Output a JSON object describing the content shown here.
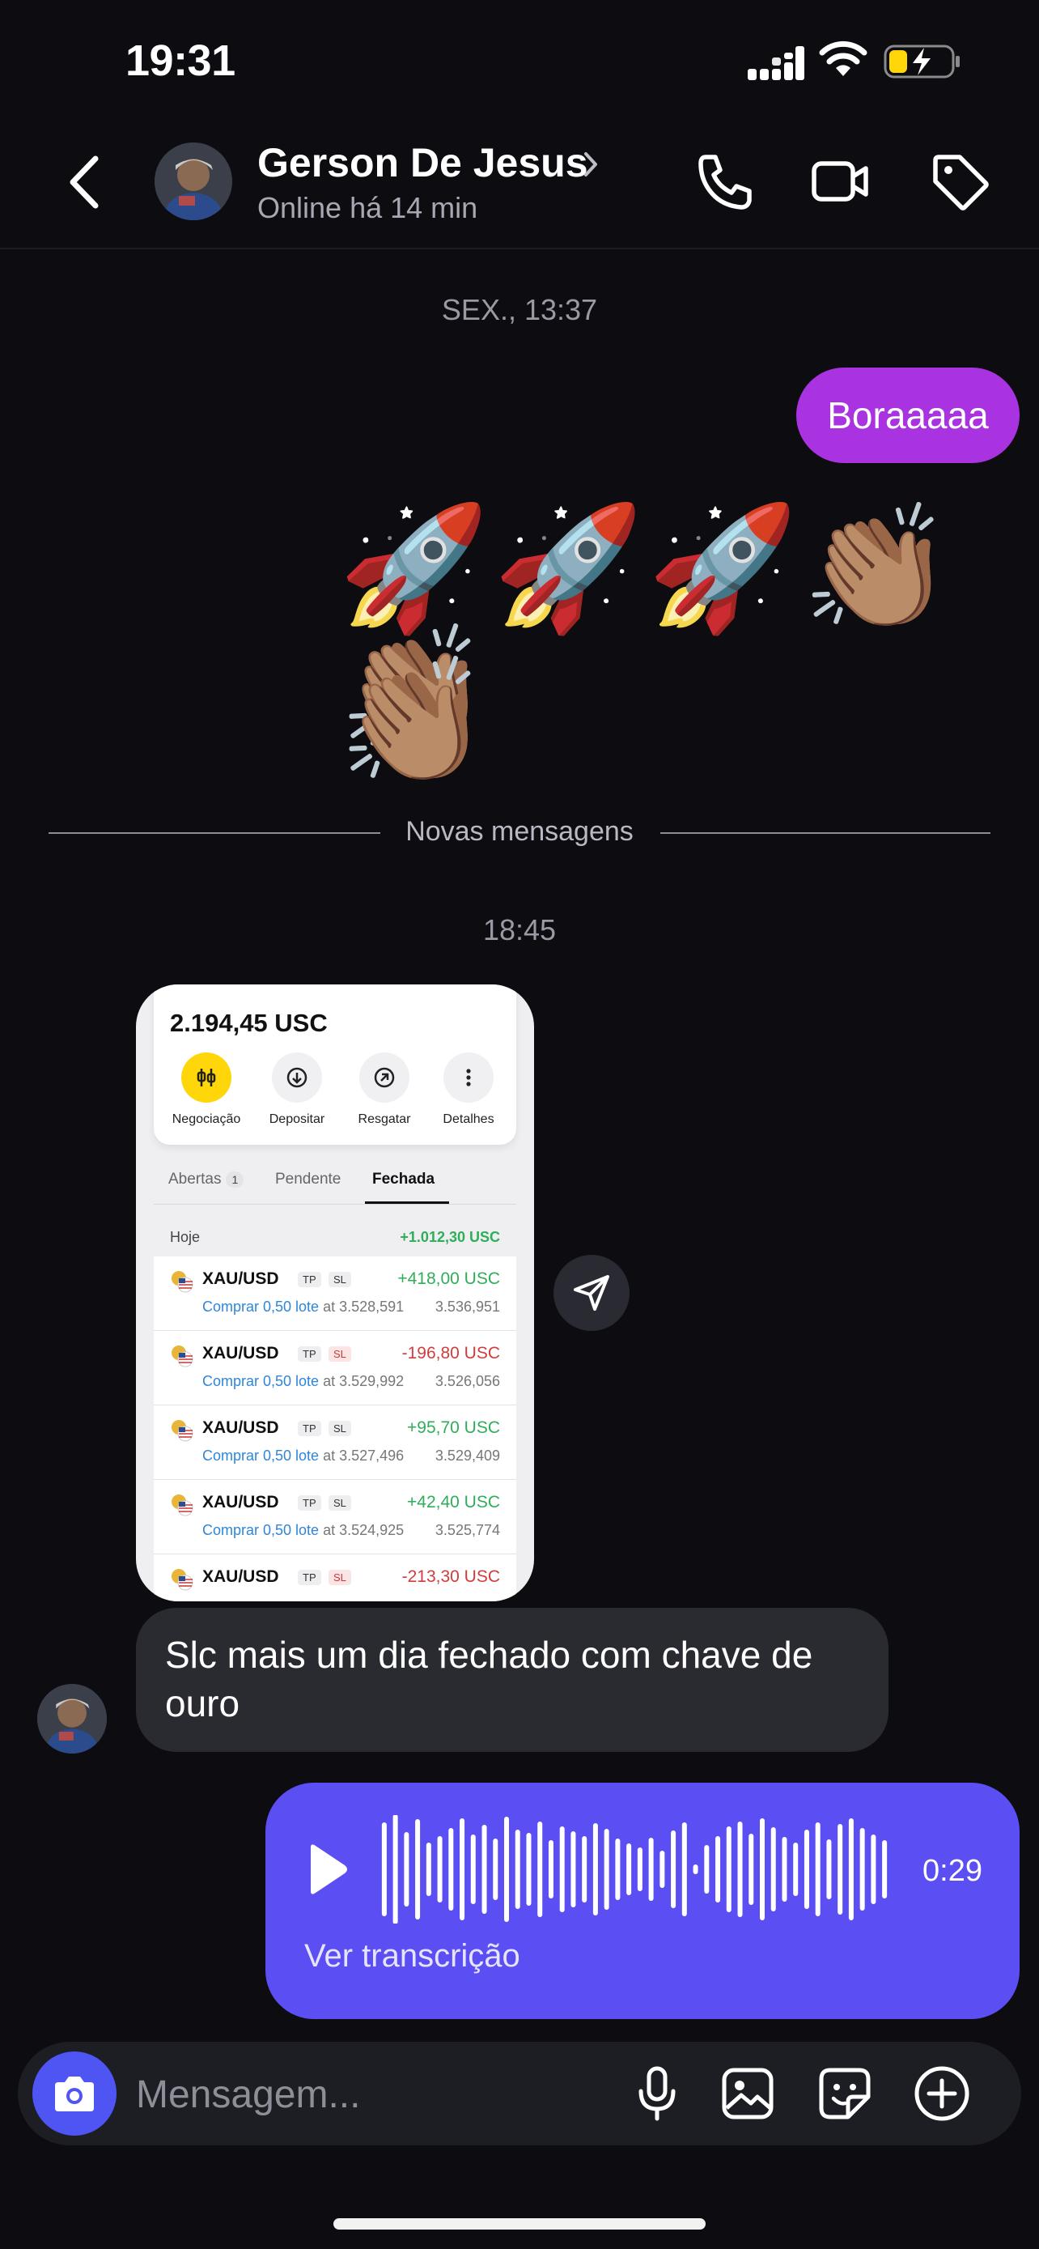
{
  "status_bar": {
    "time": "19:31"
  },
  "header": {
    "contact_name": "Gerson De Jesus",
    "status": "Online há 14 min"
  },
  "chat": {
    "date_1": "SEX., 13:37",
    "outgoing_text": "Boraaaaa",
    "emoji_row_1": "🚀🚀🚀👏🏽👏🏽",
    "emoji_row_2": "👏🏽",
    "divider_label": "Novas mensagens",
    "date_2": "18:45",
    "incoming_text": "Slc mais um dia fechado com chave de ouro",
    "voice": {
      "duration": "0:29",
      "transcript_label": "Ver transcrição"
    }
  },
  "screenshot": {
    "balance": "2.194,45 USC",
    "actions": [
      "Negociação",
      "Depositar",
      "Resgatar",
      "Detalhes"
    ],
    "tabs": {
      "open": "Abertas",
      "open_count": "1",
      "pending": "Pendente",
      "closed": "Fechada"
    },
    "today_label": "Hoje",
    "today_total": "+1.012,30 USC",
    "trades": [
      {
        "symbol": "XAU/USD",
        "tp": "TP",
        "sl": "SL",
        "pnl": "+418,00 USC",
        "action": "Comprar 0,50 lote",
        "open": "at 3.528,591",
        "close": "3.536,951"
      },
      {
        "symbol": "XAU/USD",
        "tp": "TP",
        "sl": "SL",
        "pnl": "-196,80 USC",
        "action": "Comprar 0,50 lote",
        "open": "at 3.529,992",
        "close": "3.526,056"
      },
      {
        "symbol": "XAU/USD",
        "tp": "TP",
        "sl": "SL",
        "pnl": "+95,70 USC",
        "action": "Comprar 0,50 lote",
        "open": "at 3.527,496",
        "close": "3.529,409"
      },
      {
        "symbol": "XAU/USD",
        "tp": "TP",
        "sl": "SL",
        "pnl": "+42,40 USC",
        "action": "Comprar 0,50 lote",
        "open": "at 3.524,925",
        "close": "3.525,774"
      },
      {
        "symbol": "XAU/USD",
        "tp": "TP",
        "sl": "SL",
        "pnl": "-213,30 USC",
        "action": "",
        "open": "",
        "close": ""
      }
    ]
  },
  "composer": {
    "placeholder": "Mensagem..."
  },
  "colors": {
    "outgoing_bubble": "#a933e0",
    "voice_bubble": "#5b4ef2",
    "camera_button": "#4f55f2",
    "positive": "#2fae5a",
    "negative": "#d23c3c"
  }
}
